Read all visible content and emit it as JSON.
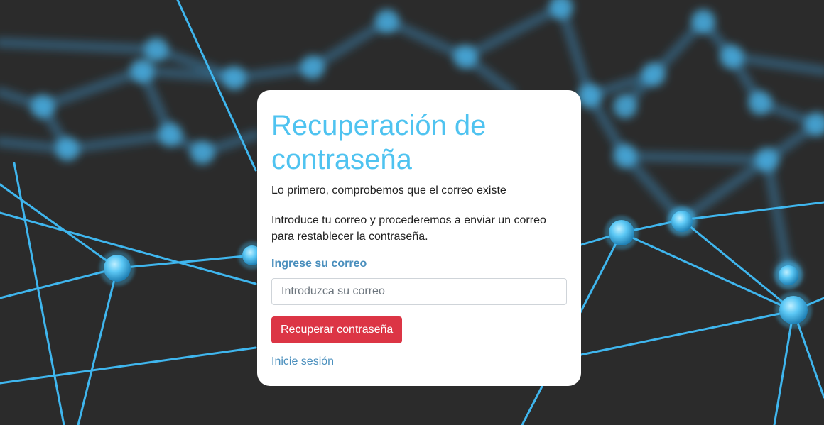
{
  "colors": {
    "background": "#2b2b2b",
    "network_line": "#3fb6ee",
    "network_node": "#5cc8f5",
    "title": "#4fc3f0",
    "accent_text": "#4a8fbd",
    "button": "#dc3545"
  },
  "background": {
    "icon": "network-graph-image"
  },
  "card": {
    "title": "Recuperación de contraseña",
    "subtitle": "Lo primero, comprobemos que el correo existe",
    "description": "Introduce tu correo y procederemos a enviar un correo para restablecer la contraseña.",
    "email_label": "Ingrese su correo",
    "email_placeholder": "Introduzca su correo",
    "email_value": "",
    "submit_label": "Recuperar contraseña",
    "login_link": "Inicie sesión"
  }
}
